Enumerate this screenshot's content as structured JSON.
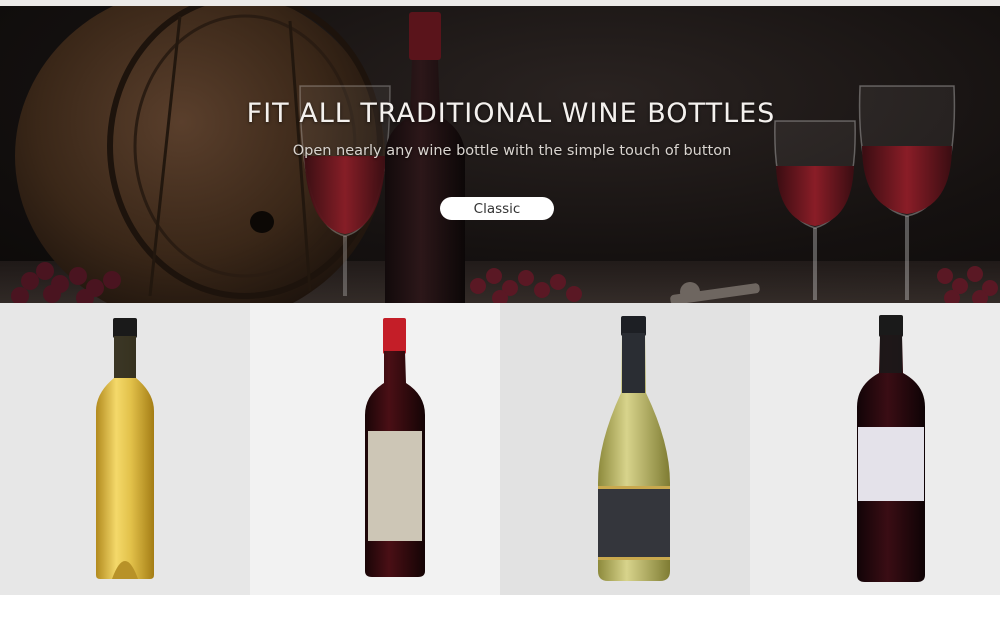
{
  "hero": {
    "title": "FIT ALL TRADITIONAL WINE BOTTLES",
    "subtitle": "Open nearly any wine bottle with the simple touch of button",
    "button_label": "Classic"
  },
  "gallery": {
    "bottles": [
      {
        "name": "gold-bottle",
        "color": "#d9b43a"
      },
      {
        "name": "red-capsule-bottle",
        "color": "#7a1c22"
      },
      {
        "name": "white-wine-bottle",
        "color": "#b9b46a"
      },
      {
        "name": "dark-red-bottle",
        "color": "#5a141b"
      }
    ]
  },
  "colors": {
    "hero_background": "#151110",
    "button_background": "#ffffff",
    "hero_text": "#f4f1ee"
  }
}
